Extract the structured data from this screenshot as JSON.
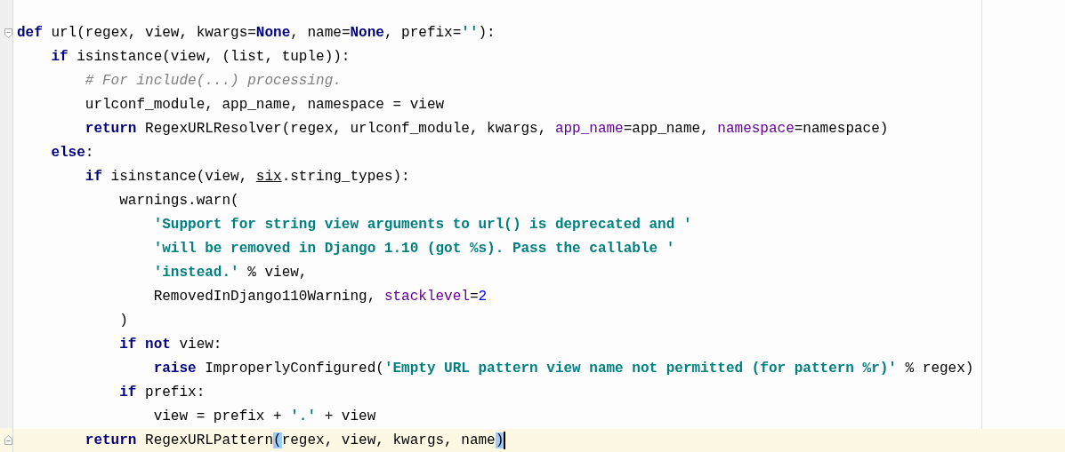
{
  "editor": {
    "lines": [
      {
        "kind": "open",
        "current": false,
        "tokens": [
          {
            "t": "def",
            "kind": "kw"
          },
          {
            "t": " url(regex, view, kwargs=",
            "kind": "plain"
          },
          {
            "t": "None",
            "kind": "kw"
          },
          {
            "t": ", name=",
            "kind": "plain"
          },
          {
            "t": "None",
            "kind": "kw"
          },
          {
            "t": ", prefix=",
            "kind": "plain"
          },
          {
            "t": "''",
            "kind": "str"
          },
          {
            "t": "):",
            "kind": "plain"
          }
        ]
      },
      {
        "kind": "body",
        "current": false,
        "tokens": [
          {
            "t": "    if",
            "kind": "kw"
          },
          {
            "t": " isinstance(view, (list, tuple)):",
            "kind": "plain"
          }
        ]
      },
      {
        "kind": "body",
        "current": false,
        "tokens": [
          {
            "t": "        # For include(...) processing.",
            "kind": "comment"
          }
        ]
      },
      {
        "kind": "body",
        "current": false,
        "tokens": [
          {
            "t": "        urlconf_module, app_name, namespace = view",
            "kind": "plain"
          }
        ]
      },
      {
        "kind": "body",
        "current": false,
        "tokens": [
          {
            "t": "        return",
            "kind": "kw"
          },
          {
            "t": " RegexURLResolver(regex, urlconf_module, kwargs, ",
            "kind": "plain"
          },
          {
            "t": "app_name",
            "kind": "param"
          },
          {
            "t": "=app_name, ",
            "kind": "plain"
          },
          {
            "t": "namespace",
            "kind": "param"
          },
          {
            "t": "=namespace)",
            "kind": "plain"
          }
        ]
      },
      {
        "kind": "body",
        "current": false,
        "tokens": [
          {
            "t": "    else",
            "kind": "kw"
          },
          {
            "t": ":",
            "kind": "plain"
          }
        ]
      },
      {
        "kind": "body",
        "current": false,
        "tokens": [
          {
            "t": "        if",
            "kind": "kw"
          },
          {
            "t": " isinstance(view, ",
            "kind": "plain"
          },
          {
            "t": "six",
            "kind": "module"
          },
          {
            "t": ".string_types):",
            "kind": "plain"
          }
        ]
      },
      {
        "kind": "body",
        "current": false,
        "tokens": [
          {
            "t": "            warnings.warn(",
            "kind": "plain"
          }
        ]
      },
      {
        "kind": "body",
        "current": false,
        "tokens": [
          {
            "t": "                'Support for string view arguments to url() is deprecated and '",
            "kind": "str"
          }
        ]
      },
      {
        "kind": "body",
        "current": false,
        "tokens": [
          {
            "t": "                'will be removed in Django 1.10 (got %s). Pass the callable '",
            "kind": "str"
          }
        ]
      },
      {
        "kind": "body",
        "current": false,
        "tokens": [
          {
            "t": "                'instead.'",
            "kind": "str"
          },
          {
            "t": " % view,",
            "kind": "plain"
          }
        ]
      },
      {
        "kind": "body",
        "current": false,
        "tokens": [
          {
            "t": "                RemovedInDjango110Warning, ",
            "kind": "plain"
          },
          {
            "t": "stacklevel",
            "kind": "param"
          },
          {
            "t": "=",
            "kind": "plain"
          },
          {
            "t": "2",
            "kind": "num"
          }
        ]
      },
      {
        "kind": "body",
        "current": false,
        "tokens": [
          {
            "t": "            )",
            "kind": "plain"
          }
        ]
      },
      {
        "kind": "body",
        "current": false,
        "tokens": [
          {
            "t": "            if not",
            "kind": "kw"
          },
          {
            "t": " view:",
            "kind": "plain"
          }
        ]
      },
      {
        "kind": "body",
        "current": false,
        "tokens": [
          {
            "t": "                raise",
            "kind": "kw"
          },
          {
            "t": " ImproperlyConfigured(",
            "kind": "plain"
          },
          {
            "t": "'Empty URL pattern view name not permitted (for pattern %r)'",
            "kind": "str"
          },
          {
            "t": " % regex)",
            "kind": "plain"
          }
        ]
      },
      {
        "kind": "body",
        "current": false,
        "tokens": [
          {
            "t": "            if",
            "kind": "kw"
          },
          {
            "t": " prefix:",
            "kind": "plain"
          }
        ]
      },
      {
        "kind": "body",
        "current": false,
        "tokens": [
          {
            "t": "                view = prefix + ",
            "kind": "plain"
          },
          {
            "t": "'.'",
            "kind": "str"
          },
          {
            "t": " + view",
            "kind": "plain"
          }
        ]
      },
      {
        "kind": "close",
        "current": true,
        "caret": true,
        "tokens": [
          {
            "t": "        return",
            "kind": "kw"
          },
          {
            "t": " RegexURLPattern",
            "kind": "plain"
          },
          {
            "t": "(",
            "kind": "brace",
            "matched": true
          },
          {
            "t": "regex, view, kwargs, name",
            "kind": "plain"
          },
          {
            "t": ")",
            "kind": "brace",
            "matched": true
          }
        ]
      }
    ]
  }
}
